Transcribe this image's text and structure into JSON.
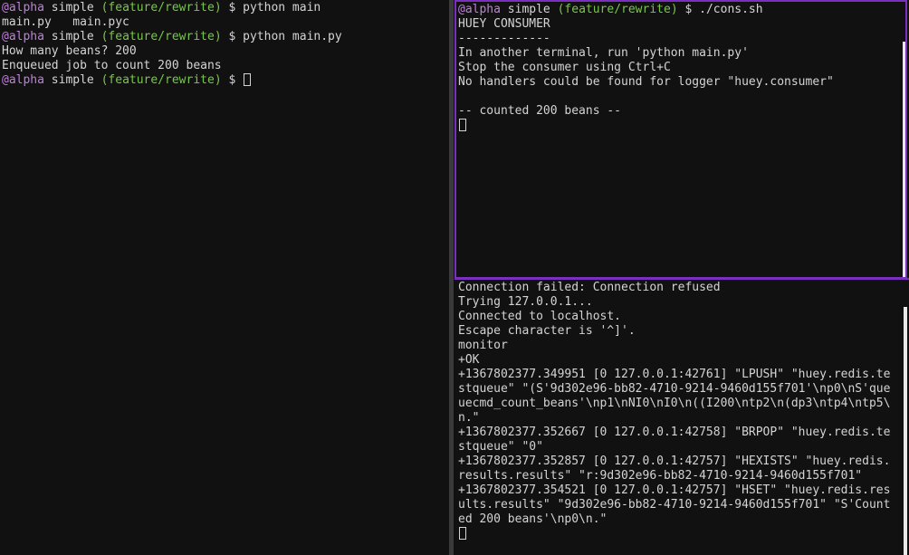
{
  "colors": {
    "background": "#111111",
    "text": "#d4d4d4",
    "prompt_user": "#c07fe0",
    "prompt_branch": "#78c74b",
    "active_pane_border": "#7b2fbf"
  },
  "left_pane": {
    "prompt": {
      "user": "@alpha",
      "dir": " simple ",
      "branch": "(feature/rewrite)",
      "symbol": " $ "
    },
    "cmd1": "python main",
    "completion": "main.py   main.pyc",
    "cmd2": "python main.py",
    "output": [
      "How many beans? 200",
      "Enqueued job to count 200 beans"
    ]
  },
  "top_right_pane": {
    "prompt": {
      "user": "@alpha",
      "dir": " simple ",
      "branch": "(feature/rewrite)",
      "symbol": " $ "
    },
    "cmd": "./cons.sh",
    "output": [
      "HUEY CONSUMER",
      "-------------",
      "In another terminal, run 'python main.py'",
      "Stop the consumer using Ctrl+C",
      "No handlers could be found for logger \"huey.consumer\"",
      "",
      "-- counted 200 beans --"
    ]
  },
  "bottom_right_pane": {
    "output": [
      "Connection failed: Connection refused",
      "Trying 127.0.0.1...",
      "Connected to localhost.",
      "Escape character is '^]'.",
      "monitor",
      "+OK",
      "+1367802377.349951 [0 127.0.0.1:42761] \"LPUSH\" \"huey.redis.te",
      "stqueue\" \"(S'9d302e96-bb82-4710-9214-9460d155f701'\\np0\\nS'que",
      "uecmd_count_beans'\\np1\\nNI0\\nI0\\n((I200\\ntp2\\n(dp3\\ntp4\\ntp5\\",
      "n.\"",
      "+1367802377.352667 [0 127.0.0.1:42758] \"BRPOP\" \"huey.redis.te",
      "stqueue\" \"0\"",
      "+1367802377.352857 [0 127.0.0.1:42757] \"HEXISTS\" \"huey.redis.",
      "results.results\" \"r:9d302e96-bb82-4710-9214-9460d155f701\"",
      "+1367802377.354521 [0 127.0.0.1:42757] \"HSET\" \"huey.redis.res",
      "ults.results\" \"9d302e96-bb82-4710-9214-9460d155f701\" \"S'Count",
      "ed 200 beans'\\np0\\n.\""
    ]
  }
}
